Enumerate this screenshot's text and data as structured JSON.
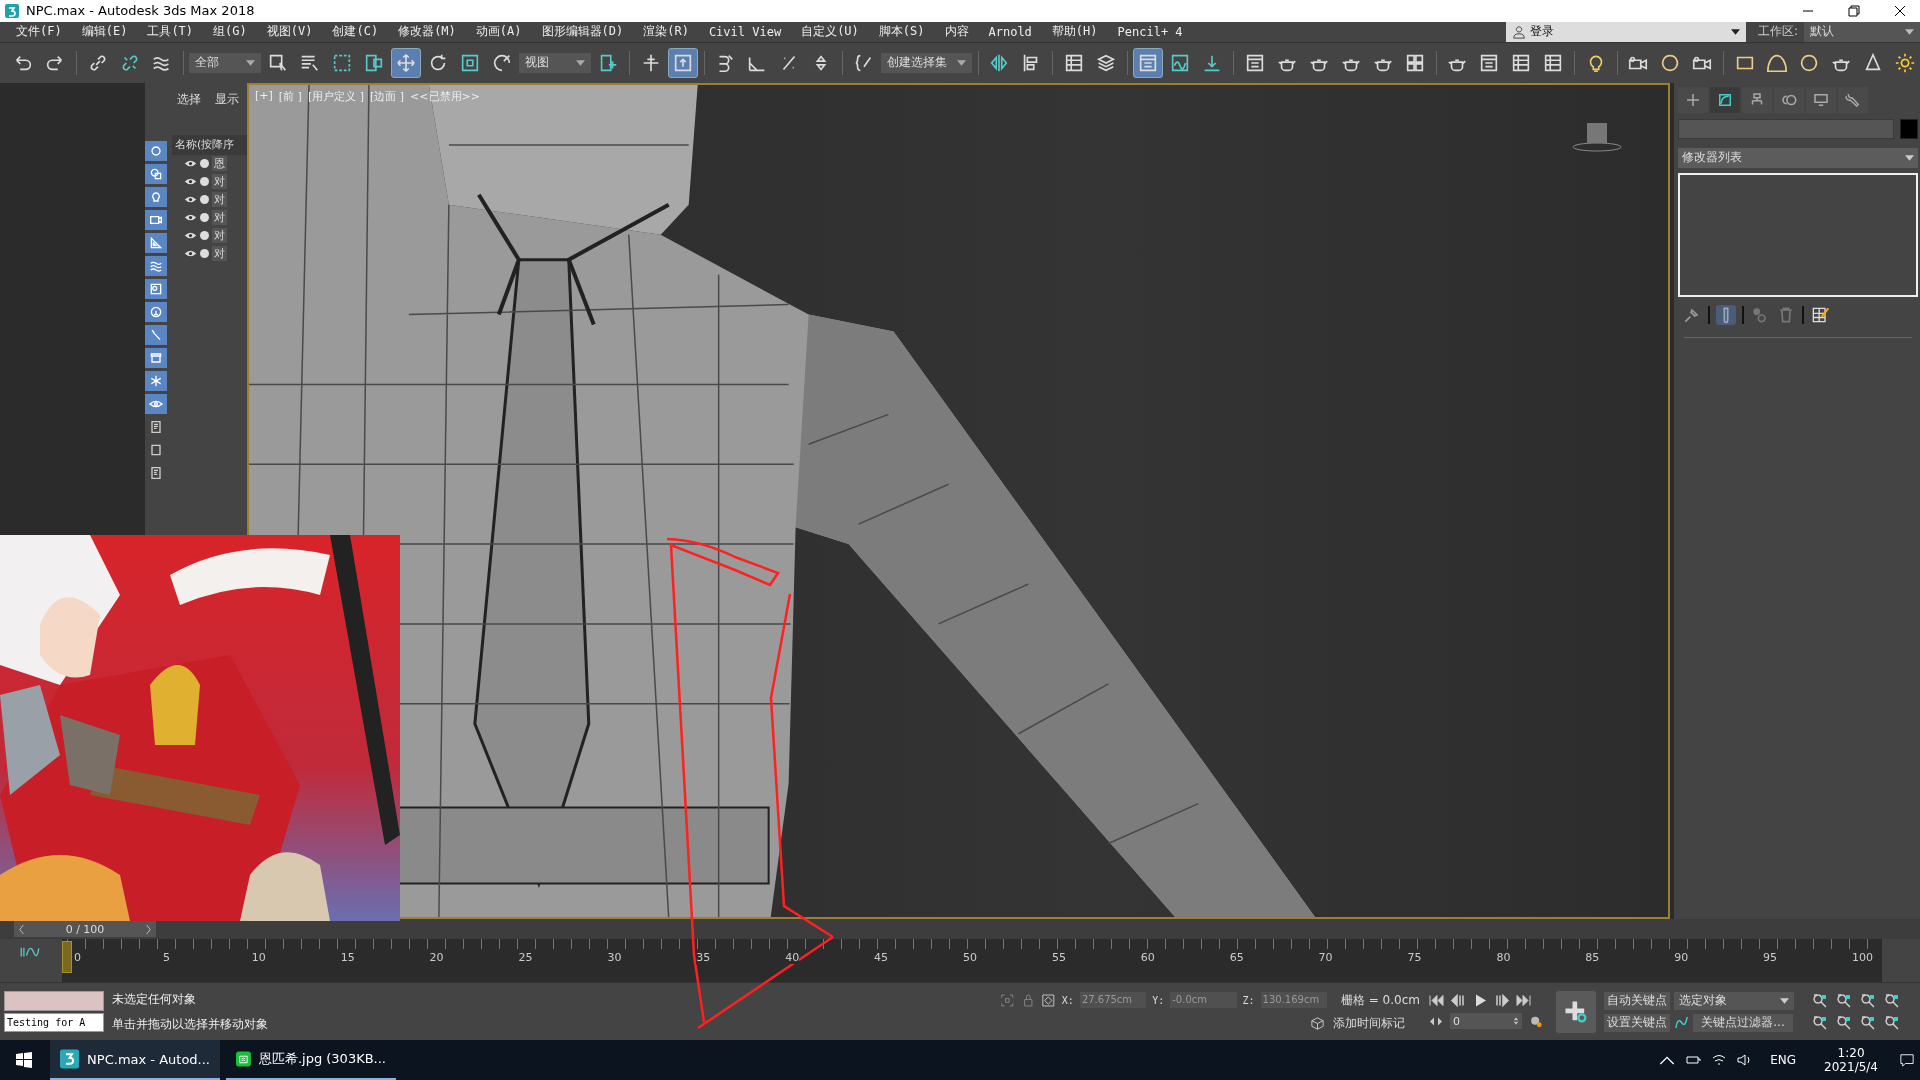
{
  "window": {
    "title": "NPC.max - Autodesk 3ds Max 2018"
  },
  "menu": [
    "文件(F)",
    "编辑(E)",
    "工具(T)",
    "组(G)",
    "视图(V)",
    "创建(C)",
    "修改器(M)",
    "动画(A)",
    "图形编辑器(D)",
    "渲染(R)",
    "Civil View",
    "自定义(U)",
    "脚本(S)",
    "内容",
    "Arnold",
    "帮助(H)",
    "Pencil+ 4"
  ],
  "account": {
    "label": "登录"
  },
  "workspace": {
    "label": "工作区:",
    "value": "默认"
  },
  "toolbar": [
    {
      "items": [
        {
          "kind": "undo",
          "active": false
        },
        {
          "kind": "redo",
          "active": false
        }
      ]
    },
    {
      "items": [
        {
          "kind": "link",
          "active": false
        },
        {
          "kind": "unlink",
          "active": false
        },
        {
          "kind": "bind",
          "active": false
        }
      ]
    },
    {
      "items": [
        {
          "kind": "dropdown",
          "value": "全部"
        },
        {
          "kind": "select",
          "active": false
        },
        {
          "kind": "selname",
          "active": false
        },
        {
          "kind": "rect",
          "active": false
        },
        {
          "kind": "window",
          "active": false
        },
        {
          "kind": "move",
          "active": true
        },
        {
          "kind": "rotate",
          "active": false
        },
        {
          "kind": "scale",
          "active": false
        },
        {
          "kind": "place",
          "active": false
        },
        {
          "kind": "dropdown",
          "value": "视图"
        },
        {
          "kind": "pivot",
          "active": false
        }
      ]
    },
    {
      "items": [
        {
          "kind": "cross",
          "active": false
        },
        {
          "kind": "uparrow",
          "active": true
        }
      ]
    },
    {
      "items": [
        {
          "kind": "snap",
          "active": false
        },
        {
          "kind": "angle",
          "active": false
        },
        {
          "kind": "percent",
          "active": false
        },
        {
          "kind": "spin",
          "active": false
        }
      ]
    },
    {
      "items": [
        {
          "kind": "brace",
          "active": false
        },
        {
          "kind": "dropdown",
          "value": "创建选择集"
        }
      ]
    },
    {
      "items": [
        {
          "kind": "mirror",
          "active": false
        },
        {
          "kind": "align",
          "active": false
        }
      ]
    },
    {
      "items": [
        {
          "kind": "table",
          "active": false
        },
        {
          "kind": "layers",
          "active": false
        }
      ]
    },
    {
      "items": [
        {
          "kind": "panel",
          "active": true
        },
        {
          "kind": "curve",
          "active": false
        },
        {
          "kind": "dope",
          "active": false
        }
      ]
    },
    {
      "items": [
        {
          "kind": "panel",
          "active": false
        },
        {
          "kind": "teapot",
          "active": false
        },
        {
          "kind": "teapot",
          "active": false
        },
        {
          "kind": "teapot",
          "active": false
        },
        {
          "kind": "teapot",
          "active": false
        },
        {
          "kind": "grid",
          "active": false
        }
      ]
    },
    {
      "items": [
        {
          "kind": "teapot",
          "active": false
        },
        {
          "kind": "panel",
          "active": false
        },
        {
          "kind": "table",
          "active": false
        },
        {
          "kind": "table",
          "active": false
        }
      ]
    },
    {
      "items": [
        {
          "kind": "bulb",
          "active": false
        }
      ]
    },
    {
      "items": [
        {
          "kind": "camera",
          "active": false
        },
        {
          "kind": "sphere",
          "active": false
        },
        {
          "kind": "camera",
          "active": false
        }
      ]
    },
    {
      "items": [
        {
          "kind": "box",
          "active": false
        },
        {
          "kind": "dome",
          "active": false
        },
        {
          "kind": "sphere",
          "active": false
        },
        {
          "kind": "teapot",
          "active": false
        },
        {
          "kind": "cone",
          "active": false
        },
        {
          "kind": "sun",
          "active": false
        }
      ]
    }
  ],
  "explorer": {
    "tabs": [
      "选择",
      "显示"
    ],
    "filters": [
      {
        "active": true
      },
      {
        "active": true
      },
      {
        "active": true
      },
      {
        "active": true
      },
      {
        "active": true
      },
      {
        "active": true
      },
      {
        "active": true
      },
      {
        "active": true
      },
      {
        "active": true
      },
      {
        "active": true
      },
      {
        "active": true
      },
      {
        "active": true
      },
      {
        "active": false
      },
      {
        "active": false
      },
      {
        "active": false
      }
    ],
    "column": "名称(按降序",
    "rows": [
      "恩",
      "对",
      "对",
      "对",
      "对",
      "对"
    ]
  },
  "viewport": {
    "labels": [
      "[+]",
      "[前 ]",
      "[用户定义 ]",
      "[边面 ]",
      "<<已禁用>>"
    ]
  },
  "command_panel": {
    "tabs": [
      {
        "kind": "create",
        "selected": false
      },
      {
        "kind": "modify",
        "selected": true
      },
      {
        "kind": "hierarchy",
        "selected": false
      },
      {
        "kind": "motion",
        "selected": false
      },
      {
        "kind": "display",
        "selected": false
      },
      {
        "kind": "utilities",
        "selected": false
      }
    ],
    "modifier_list": "修改器列表"
  },
  "time_slider": {
    "label": "0 / 100"
  },
  "track_ticks": [
    "0",
    "5",
    "10",
    "15",
    "20",
    "25",
    "30",
    "35",
    "40",
    "45",
    "50",
    "55",
    "60",
    "65",
    "70",
    "75",
    "80",
    "85",
    "90",
    "95",
    "100"
  ],
  "status": {
    "listener": "Testing for A",
    "messages": [
      "未选定任何对象",
      "单击并拖动以选择并移动对象"
    ],
    "x_label": "X:",
    "x": "27.675cm",
    "y_label": "Y:",
    "y": "-0.0cm",
    "z_label": "Z:",
    "z": "130.169cm",
    "grid": "栅格 = 0.0cm",
    "time_tag": "添加时间标记",
    "frame": "0",
    "auto_key": "自动关键点",
    "key_mode": "选定对象",
    "set_key": "设置关键点",
    "key_filters": "关键点过滤器..."
  },
  "taskbar": {
    "apps": [
      {
        "kind": "max",
        "label": "NPC.max - Autod..."
      },
      {
        "kind": "viewer",
        "label": "恩匹希.jpg (303KB..."
      }
    ],
    "language": "ENG",
    "time": "1:20",
    "date": "2021/5/4"
  }
}
